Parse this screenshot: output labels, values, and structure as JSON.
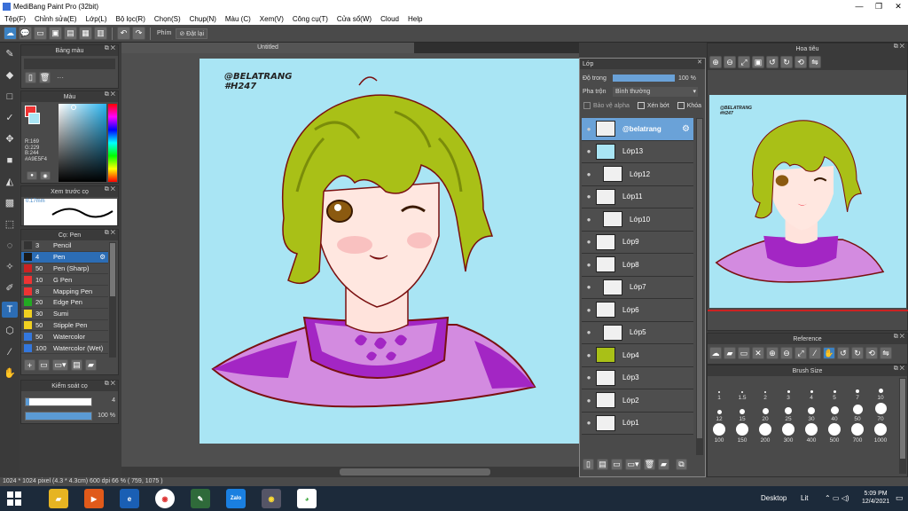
{
  "window": {
    "title": "MediBang Paint Pro (32bit)"
  },
  "menu": [
    "Tệp(F)",
    "Chỉnh sửa(E)",
    "Lớp(L)",
    "Bộ lọc(R)",
    "Chọn(S)",
    "Chụp(N)",
    "Màu (C)",
    "Xem(V)",
    "Công cụ(T)",
    "Cửa sổ(W)",
    "Cloud",
    "Help"
  ],
  "toolbar": {
    "phim_label": "Phím",
    "reset_label": "Đặt lại"
  },
  "panels": {
    "palette": {
      "title": "Bảng màu",
      "dots": "···"
    },
    "color": {
      "title": "Màu",
      "r": "R:169",
      "g": "G:229",
      "b": "B:244",
      "hex": "#A9E5F4",
      "main_color": "#a9e5f4"
    },
    "preview": {
      "title": "Xem trước cọ",
      "size": "0.17mm"
    },
    "brush": {
      "title": "Cọ: Pen",
      "items": [
        {
          "size": "3",
          "name": "Pencil",
          "color": "#333333"
        },
        {
          "size": "4",
          "name": "Pen",
          "color": "#1a1a1a"
        },
        {
          "size": "50",
          "name": "Pen (Sharp)",
          "color": "#cc2222"
        },
        {
          "size": "10",
          "name": "G Pen",
          "color": "#ee3333"
        },
        {
          "size": "8",
          "name": "Mapping Pen",
          "color": "#ee3333"
        },
        {
          "size": "20",
          "name": "Edge Pen",
          "color": "#22aa22"
        },
        {
          "size": "30",
          "name": "Sumi",
          "color": "#f0d020"
        },
        {
          "size": "50",
          "name": "Stipple Pen",
          "color": "#f0d020"
        },
        {
          "size": "50",
          "name": "Watercolor",
          "color": "#3377dd"
        },
        {
          "size": "100",
          "name": "Watercolor (Wet)",
          "color": "#3377dd"
        }
      ]
    },
    "brush_control": {
      "title": "Kiểm soát cọ",
      "size": "4",
      "opacity": "100 %",
      "size_fraction": 0.05,
      "opacity_fraction": 1.0
    }
  },
  "canvas": {
    "tab_title": "Untitled",
    "watermark_line1": "@BELATRANG",
    "watermark_line2": "#H247",
    "bg_color": "#a9e5f4"
  },
  "layers": {
    "title": "Lớp",
    "opacity_label": "Độ trong",
    "opacity_value": "100 %",
    "blend_label": "Pha trộn",
    "blend_value": "Bình thường",
    "protect_alpha": "Bảo vệ alpha",
    "clip": "Xén bớt",
    "lock": "Khóa",
    "items": [
      {
        "name": "@belatrang",
        "selected": true,
        "indent": false
      },
      {
        "name": "Lớp13",
        "selected": false,
        "indent": false
      },
      {
        "name": "Lớp12",
        "selected": false,
        "indent": true
      },
      {
        "name": "Lớp11",
        "selected": false,
        "indent": false
      },
      {
        "name": "Lớp10",
        "selected": false,
        "indent": true
      },
      {
        "name": "Lớp9",
        "selected": false,
        "indent": false
      },
      {
        "name": "Lớp8",
        "selected": false,
        "indent": false
      },
      {
        "name": "Lớp7",
        "selected": false,
        "indent": true
      },
      {
        "name": "Lớp6",
        "selected": false,
        "indent": false
      },
      {
        "name": "Lớp5",
        "selected": false,
        "indent": true
      },
      {
        "name": "Lớp4",
        "selected": false,
        "indent": false
      },
      {
        "name": "Lớp3",
        "selected": false,
        "indent": false
      },
      {
        "name": "Lớp2",
        "selected": false,
        "indent": false
      },
      {
        "name": "Lớp1",
        "selected": false,
        "indent": false
      }
    ]
  },
  "navigator": {
    "title": "Hoa tiêu",
    "watermark_line1": "@BELATRANG",
    "watermark_line2": "#H247"
  },
  "reference": {
    "title": "Reference"
  },
  "brush_size": {
    "title": "Brush Size",
    "sizes": [
      "1",
      "1.5",
      "2",
      "3",
      "4",
      "5",
      "7",
      "10",
      "12",
      "15",
      "20",
      "25",
      "30",
      "40",
      "50",
      "70",
      "100",
      "150",
      "200",
      "300",
      "400",
      "500",
      "700",
      "1000"
    ]
  },
  "status": {
    "text": "1024 * 1024 pixel   (4.3 * 4.3cm)   600 dpi   66 %   ( 759, 1075 )"
  },
  "taskbar": {
    "desktop": "Desktop",
    "lang": "Lit",
    "time": "5:09 PM",
    "date": "12/4/2021"
  }
}
